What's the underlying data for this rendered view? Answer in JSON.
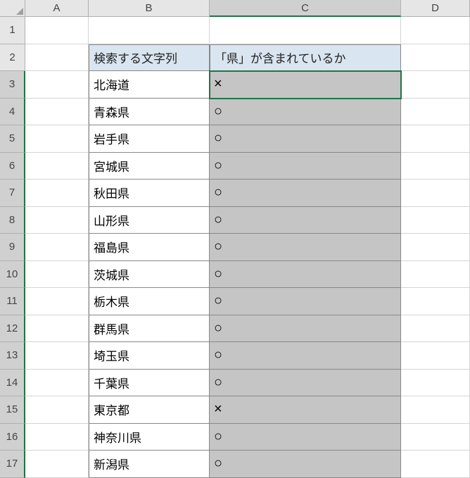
{
  "columns": [
    "A",
    "B",
    "C",
    "D"
  ],
  "headers": {
    "B": "検索する文字列",
    "C": "「県」が含まれているか"
  },
  "rows": [
    {
      "n": "1",
      "b": "",
      "c": ""
    },
    {
      "n": "2",
      "b": "",
      "c": ""
    },
    {
      "n": "3",
      "b": "北海道",
      "c": "×"
    },
    {
      "n": "4",
      "b": "青森県",
      "c": "○"
    },
    {
      "n": "5",
      "b": "岩手県",
      "c": "○"
    },
    {
      "n": "6",
      "b": "宮城県",
      "c": "○"
    },
    {
      "n": "7",
      "b": "秋田県",
      "c": "○"
    },
    {
      "n": "8",
      "b": "山形県",
      "c": "○"
    },
    {
      "n": "9",
      "b": "福島県",
      "c": "○"
    },
    {
      "n": "10",
      "b": "茨城県",
      "c": "○"
    },
    {
      "n": "11",
      "b": "栃木県",
      "c": "○"
    },
    {
      "n": "12",
      "b": "群馬県",
      "c": "○"
    },
    {
      "n": "13",
      "b": "埼玉県",
      "c": "○"
    },
    {
      "n": "14",
      "b": "千葉県",
      "c": "○"
    },
    {
      "n": "15",
      "b": "東京都",
      "c": "×"
    },
    {
      "n": "16",
      "b": "神奈川県",
      "c": "○"
    },
    {
      "n": "17",
      "b": "新潟県",
      "c": "○"
    }
  ],
  "selected_column": "C",
  "active_cell": "C3"
}
